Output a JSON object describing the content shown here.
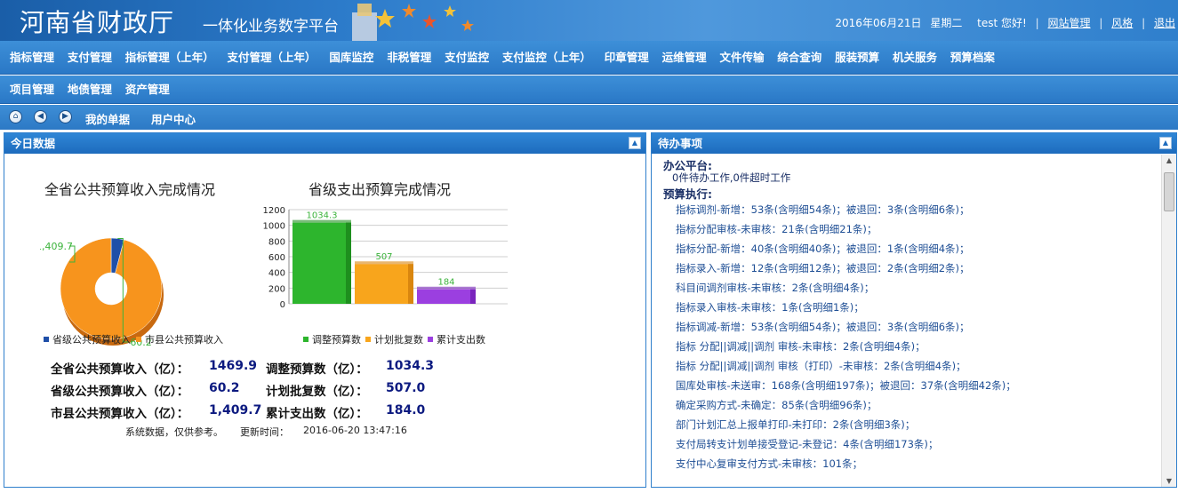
{
  "header": {
    "site_title": "河南省财政厅",
    "platform_name": "一体化业务数字平台",
    "date": "2016年06月21日",
    "weekday": "星期二",
    "user_greeting": "test 您好!",
    "links": [
      "网站管理",
      "风格",
      "退出"
    ]
  },
  "nav_primary": [
    "指标管理",
    "支付管理",
    "指标管理（上年）",
    "支付管理（上年）",
    "国库监控",
    "非税管理",
    "支付监控",
    "支付监控（上年）",
    "印章管理",
    "运维管理",
    "文件传输",
    "综合查询",
    "服装预算",
    "机关服务",
    "预算档案"
  ],
  "nav_secondary": [
    "项目管理",
    "地债管理",
    "资产管理"
  ],
  "toolbar": {
    "home_icon": "home-icon",
    "back_icon": "back-arrow-icon",
    "forward_icon": "forward-arrow-icon",
    "my_forms": "我的单据",
    "user_center": "用户中心"
  },
  "today_panel": {
    "title": "今日数据",
    "stats": [
      {
        "label": "全省公共预算收入（亿）：",
        "value": "1469.9"
      },
      {
        "label": "省级公共预算收入（亿）：",
        "value": "60.2"
      },
      {
        "label": "市县公共预算收入（亿）：",
        "value": "1,409.7"
      },
      {
        "label": "调整预算数（亿）：",
        "value": "1034.3"
      },
      {
        "label": "计划批复数（亿）：",
        "value": "507.0"
      },
      {
        "label": "累计支出数（亿）：",
        "value": "184.0"
      }
    ],
    "note": "系统数据，仅供参考。",
    "update_label": "更新时间：",
    "update_time": "2016-06-20 13:47:16"
  },
  "chart_data": [
    {
      "type": "pie",
      "title": "全省公共预算收入完成情况",
      "categories": [
        "省级公共预算收入",
        "市县公共预算收入"
      ],
      "values": [
        60.2,
        1409.7
      ],
      "data_labels": [
        "60.2",
        "1,409.7"
      ],
      "colors": [
        "#1f4fa8",
        "#f7941d"
      ],
      "legend": "bottom"
    },
    {
      "type": "bar",
      "title": "省级支出预算完成情况",
      "categories": [
        "调整预算数",
        "计划批复数",
        "累计支出数"
      ],
      "values": [
        1034.3,
        507,
        184
      ],
      "data_labels": [
        "1034.3",
        "507",
        "184"
      ],
      "colors": [
        "#2db52d",
        "#f8a51c",
        "#9b3fe0"
      ],
      "ylim": [
        0,
        1200
      ],
      "yticks": [
        "0",
        "200",
        "400",
        "600",
        "800",
        "1000",
        "1200"
      ],
      "grid": true,
      "legend": "bottom"
    }
  ],
  "todo_panel": {
    "title": "待办事项",
    "groups": [
      {
        "title": "办公平台:",
        "lines": [
          "0件待办工作,0件超时工作"
        ]
      },
      {
        "title": "预算执行:",
        "lines": [
          "指标调剂-新增：53条(含明细54条)；被退回：3条(含明细6条)；",
          "指标分配审核-未审核：21条(含明细21条)；",
          "指标分配-新增：40条(含明细40条)；被退回：1条(含明细4条)；",
          "指标录入-新增：12条(含明细12条)；被退回：2条(含明细2条)；",
          "科目间调剂审核-未审核：2条(含明细4条)；",
          "指标录入审核-未审核：1条(含明细1条)；",
          "指标调减-新增：53条(含明细54条)；被退回：3条(含明细6条)；",
          "指标 分配||调减||调剂 审核-未审核：2条(含明细4条)；",
          "指标 分配||调减||调剂 审核（打印）-未审核：2条(含明细4条)；",
          "国库处审核-未送审：168条(含明细197条)；被退回：37条(含明细42条)；",
          "确定采购方式-未确定：85条(含明细96条)；",
          "部门计划汇总上报单打印-未打印：2条(含明细3条)；",
          "支付局转支计划单接受登记-未登记：4条(含明细173条)；",
          "支付中心复审支付方式-未审核：101条；"
        ]
      }
    ]
  }
}
